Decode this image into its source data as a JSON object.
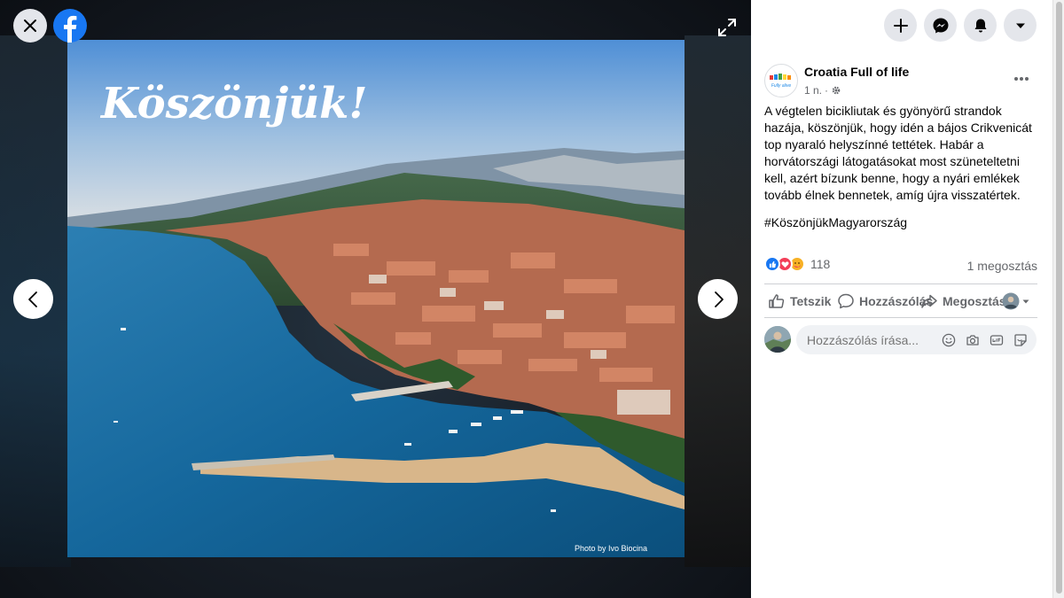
{
  "photo": {
    "overlay_title": "Köszönjük!",
    "credit": "Photo by Ivo Biocina"
  },
  "post": {
    "page_name": "Croatia Full of life",
    "avatar_text": "Fully alive",
    "time": "1 n.",
    "time_separator": "·",
    "audience_icon": "gear-icon",
    "text": "A végtelen bicikliutak és gyönyörű strandok hazája, köszönjük, hogy idén a bájos Crikvenicát top nyaraló helyszínné tettétek. Habár a horvátországi látogatásokat most szüneteltetni kell, azért bízunk benne, hogy a nyári emlékek tovább élnek bennetek, amíg újra visszatértek.",
    "hashtag": "#KöszönjükMagyarország",
    "reaction_count": "118",
    "shares": "1 megosztás"
  },
  "actions": {
    "like": "Tetszik",
    "comment": "Hozzászólás",
    "share": "Megosztás"
  },
  "comment": {
    "placeholder": "Hozzászólás írása..."
  },
  "colors": {
    "brand": "#1877f2",
    "like_blue": "#1877f2",
    "love_red": "#f33e58",
    "care_yellow": "#f7b125",
    "secondary_text": "#65676b"
  }
}
